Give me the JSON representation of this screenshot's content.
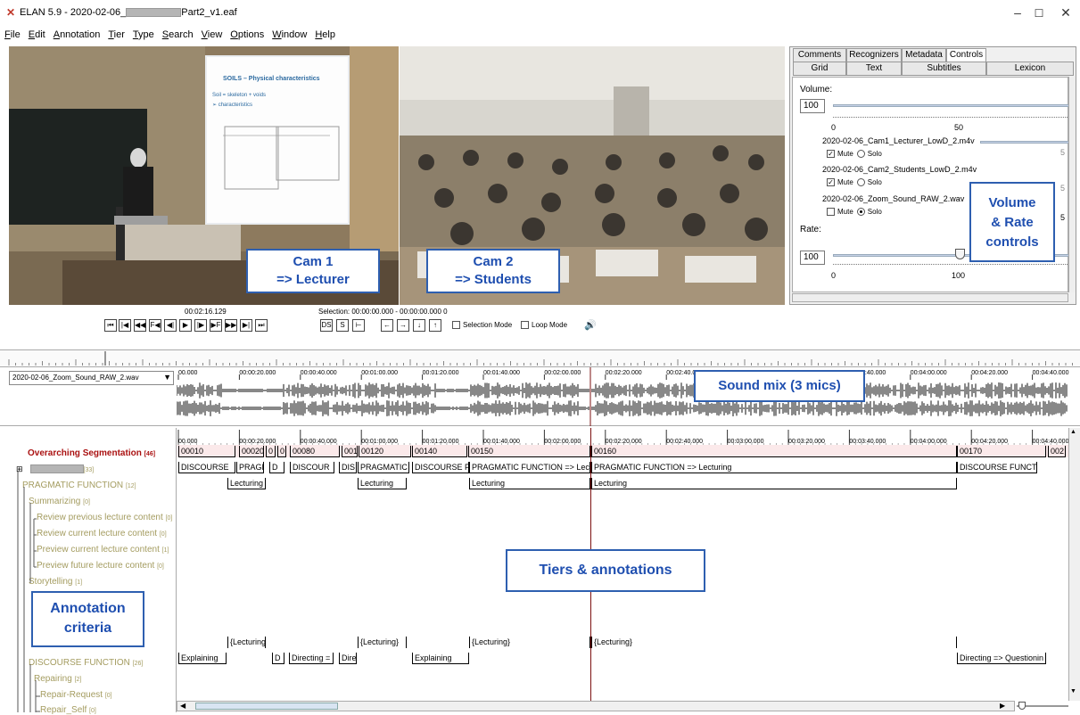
{
  "window": {
    "title_prefix": "ELAN 5.9 - 2020-02-06_",
    "title_suffix": "Part2_v1.eaf",
    "minimize": "–",
    "maximize": "☐",
    "close": "✕"
  },
  "menu": [
    "File",
    "Edit",
    "Annotation",
    "Tier",
    "Type",
    "Search",
    "View",
    "Options",
    "Window",
    "Help"
  ],
  "videos": {
    "cam1_label_line1": "Cam 1",
    "cam1_label_line2": "=> Lecturer",
    "cam2_label_line1": "Cam 2",
    "cam2_label_line2": "=> Students",
    "slide_title": "SOILS – Physical characteristics",
    "slide_line1": "Soil  = skeleton + voids",
    "slide_line2": "➢  characteristics"
  },
  "right_panel": {
    "tabs_row1": [
      "Comments",
      "Recognizers",
      "Metadata",
      "Controls"
    ],
    "tabs_row2": [
      "Grid",
      "Text",
      "Subtitles",
      "Lexicon"
    ],
    "selected_tab": "Controls",
    "volume_label": "Volume:",
    "volume_value": "100",
    "volume_ticks": [
      "0",
      "50"
    ],
    "tracks": [
      {
        "name": "2020-02-06_Cam1_Lecturer_LowD_2.m4v",
        "mute": true,
        "solo": false,
        "side": "5"
      },
      {
        "name": "2020-02-06_Cam2_Students_LowD_2.m4v",
        "mute": true,
        "solo": false,
        "side": "5"
      },
      {
        "name": "2020-02-06_Zoom_Sound_RAW_2.wav",
        "mute": false,
        "solo": true,
        "side": "5"
      }
    ],
    "mute_label": "Mute",
    "solo_label": "Solo",
    "rate_label": "Rate:",
    "rate_value": "100",
    "rate_ticks": [
      "0",
      "100"
    ],
    "note_line1": "Volume",
    "note_line2": "& Rate",
    "note_line3": "controls"
  },
  "player": {
    "current_time": "00:02:16.129",
    "selection": "Selection: 00:00:00.000 - 00:00:00.000  0",
    "selection_mode": "Selection Mode",
    "loop_mode": "Loop Mode",
    "nav_buttons": [
      "⏮",
      "|◀",
      "◀◀",
      "F◀",
      "◀|",
      "▶",
      "|▶",
      "▶F",
      "▶▶",
      "▶|",
      "⏭"
    ],
    "sel_buttons": [
      "DS",
      "S",
      "⊢"
    ],
    "arrow_buttons": [
      "←",
      "→",
      "↓",
      "↑"
    ]
  },
  "waveform": {
    "file": "2020-02-06_Zoom_Sound_RAW_2.wav",
    "ticks": [
      "00.000",
      "00:00:20.000",
      "00:00:40.000",
      "00:01:00.000",
      "00:01:20.000",
      "00:01:40.000",
      "00:02:00.000",
      "00:02:20.000",
      "00:02:40.000",
      "00:03:00.000",
      "00:03:20.000",
      "00:03:40.000",
      "00:04:00.000",
      "00:04:20.000",
      "00:04:40.000"
    ],
    "note": "Sound mix (3 mics)"
  },
  "timeline": {
    "ticks": [
      "00.000",
      "00:00:20.000",
      "00:00:40.000",
      "00:01:00.000",
      "00:01:20.000",
      "00:01:40.000",
      "00:02:00.000",
      "00:02:20.000",
      "00:02:40.000",
      "00:03:00.000",
      "00:03:20.000",
      "00:03:40.000",
      "00:04:00.000",
      "00:04:20.000",
      "00:04:40.000"
    ],
    "note": "Tiers & annotations"
  },
  "tiers": [
    {
      "label": "Overarching Segmentation",
      "count": "[46]"
    },
    {
      "label": "",
      "count": "[33]"
    },
    {
      "label": "PRAGMATIC FUNCTION",
      "count": "[12]"
    },
    {
      "label": "Summarizing",
      "count": "[0]"
    },
    {
      "label": "Review previous lecture content",
      "count": "[0]"
    },
    {
      "label": "Review current lecture content",
      "count": "[0]"
    },
    {
      "label": "Preview current lecture content",
      "count": "[1]"
    },
    {
      "label": "Preview future lecture content",
      "count": "[0]"
    },
    {
      "label": "Storytelling",
      "count": "[1]"
    },
    {
      "label": "DISCOURSE FUNCTION",
      "count": "[26]"
    },
    {
      "label": "Repairing",
      "count": "[2]"
    },
    {
      "label": "Repair-Request",
      "count": "[0]"
    },
    {
      "label": "Repair_Self",
      "count": "[0]"
    }
  ],
  "criteria_note_line1": "Annotation",
  "criteria_note_line2": "criteria",
  "annotations": {
    "row1": [
      "00010",
      "00020",
      "0",
      "0",
      "00080",
      "001",
      "00120",
      "00140",
      "00150",
      "00160",
      "00170",
      "002"
    ],
    "row2": [
      "DISCOURSE",
      "PRAGMA",
      "D",
      "DISCOUR",
      "DIS",
      "PRAGMATIC",
      "DISCOURSE FU",
      "PRAGMATIC FUNCTION => Lecturi",
      "PRAGMATIC FUNCTION => Lecturing",
      "DISCOURSE FUNCTIO"
    ],
    "row3": [
      "Lecturing",
      "Lecturing",
      "Lecturing",
      "Lecturing"
    ],
    "row_brace": [
      "{Lecturing}",
      "{Lecturing}",
      "{Lecturing}",
      "{Lecturing}"
    ],
    "row_disc": [
      "Explaining",
      "D",
      "Directing =",
      "Dire",
      "Explaining",
      "Directing => Questionin"
    ]
  }
}
